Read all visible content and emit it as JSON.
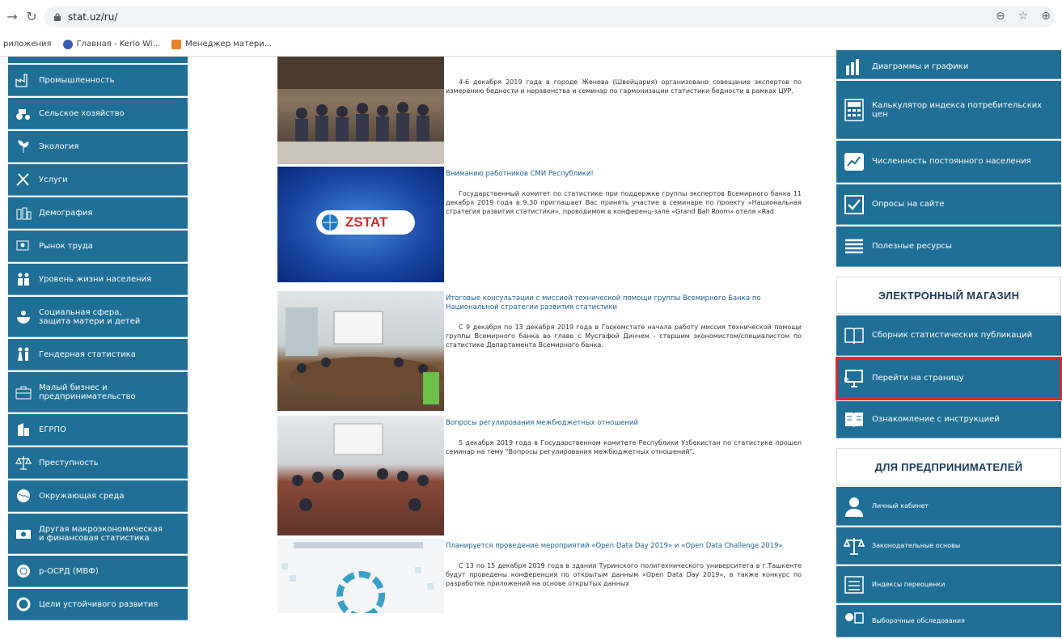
{
  "browser": {
    "url": "stat.uz/ru/",
    "bookmarks": [
      "риложения",
      "Главная - Kerio Wi...",
      "Менеджер матери..."
    ]
  },
  "sidebar": {
    "items": [
      {
        "label": "Промышленность",
        "icon": "factory-icon"
      },
      {
        "label": "Сельское хозяйство",
        "icon": "tractor-icon"
      },
      {
        "label": "Экология",
        "icon": "plant-icon"
      },
      {
        "label": "Услуги",
        "icon": "tools-icon"
      },
      {
        "label": "Демография",
        "icon": "people-icon"
      },
      {
        "label": "Рынок труда",
        "icon": "worker-icon"
      },
      {
        "label": "Уровень жизни населения",
        "icon": "family-icon"
      },
      {
        "label_line1": "Социальная сфера,",
        "label_line2": "защита матери и детей",
        "icon": "mother-child-icon"
      },
      {
        "label": "Гендерная статистика",
        "icon": "gender-icon"
      },
      {
        "label_line1": "Малый бизнес и",
        "label_line2": "предпринимательство",
        "icon": "briefcase-icon"
      },
      {
        "label": "ЕГРПО",
        "icon": "building-icon"
      },
      {
        "label": "Преступность",
        "icon": "scales-icon"
      },
      {
        "label": "Окружающая среда",
        "icon": "globe-icon"
      },
      {
        "label_line1": "Другая макроэкономическая",
        "label_line2": "и финансовая статистика",
        "icon": "money-icon"
      },
      {
        "label": "р-ОСРД (МВФ)",
        "icon": "imf-icon"
      },
      {
        "label": "Цели устойчивого развития",
        "icon": "sdg-icon"
      }
    ]
  },
  "news": [
    {
      "title": "",
      "body": "4-6 декабря 2019 года в городе Женева (Швейцария) организовано совещание экспертов по измерению бедности и неравенства и семинар по гармонизации статистики бедности в рамках ЦУР."
    },
    {
      "title": "Вниманию работников СМИ Республики!",
      "body": "Государственный комитет по статистике при поддержке группы экспертов Всемирного банка 11 декабря 2019 года в 9.30 приглашает Вас принять участие в семинаре по проекту «Национальная стратегия развития статистики», проводимом в конференц-зале «Grand Ball Room» отеля «Rad",
      "logo_text": "ZSTAT"
    },
    {
      "title": "Итоговые консультации с миссией технической помощи группы Всемирного Банка по Национальной стратегии развития статистики",
      "body": "С 9 декабря по 13 декабря 2019 года в Госкомстате начала работу миссия технической помощи группы Всемирного банка во главе с Мустафой Динчем - старшим экономистом/специалистом по статистике Департамента Всемирного банка."
    },
    {
      "title": "Вопросы регулирования межбюджетных отношений",
      "body": "5 декабря 2019 года в Государственном комитете Республики Узбекистан по статистике прошел семинар на тему \"Вопросы регулирования межбюджетных отношений\"."
    },
    {
      "title": "Планируется проведение мероприятий «Open Data Day 2019» и «Open Data Challenge 2019»",
      "body": "С 13 по 15 декабря 2019 года в здании Туринского политехнического университета в г.Ташкенте будут проведены конференция по открытым данным «Open Data Day 2019», а также конкурс по разработке приложений на основе открытых данных"
    }
  ],
  "right": {
    "top_items": [
      {
        "label": "Диаграммы и графики",
        "icon": "bar-chart-icon"
      },
      {
        "label_line1": "Калькулятор индекса потребительских",
        "label_line2": "цен",
        "icon": "calculator-icon"
      },
      {
        "label": "Численность постоянного населения",
        "icon": "population-icon"
      },
      {
        "label": "Опросы на сайте",
        "icon": "checkbox-icon"
      },
      {
        "label": "Полезные ресурсы",
        "icon": "database-icon"
      }
    ],
    "shop_title": "ЭЛЕКТРОННЫЙ МАГАЗИН",
    "shop_items": [
      {
        "label": "Сборник статистических публикаций",
        "icon": "book-icon"
      },
      {
        "label": "Перейти на страницу",
        "icon": "monitor-icon"
      },
      {
        "label": "Ознакомление с инструкцией",
        "icon": "manual-icon"
      }
    ],
    "biz_title": "ДЛЯ ПРЕДПРИНИМАТЕЛЕЙ",
    "biz_items": [
      {
        "label": "Личный кабинет",
        "icon": "user-icon"
      },
      {
        "label": "Законодательные основы",
        "icon": "scales-icon"
      },
      {
        "label": "Индексы переоценки",
        "icon": "list-icon"
      },
      {
        "label": "Выборочные обследования",
        "icon": "survey-icon"
      }
    ]
  },
  "colors": {
    "tile": "#1f6f97",
    "highlight": "#d32f2f",
    "title_link": "#1f5f94"
  }
}
